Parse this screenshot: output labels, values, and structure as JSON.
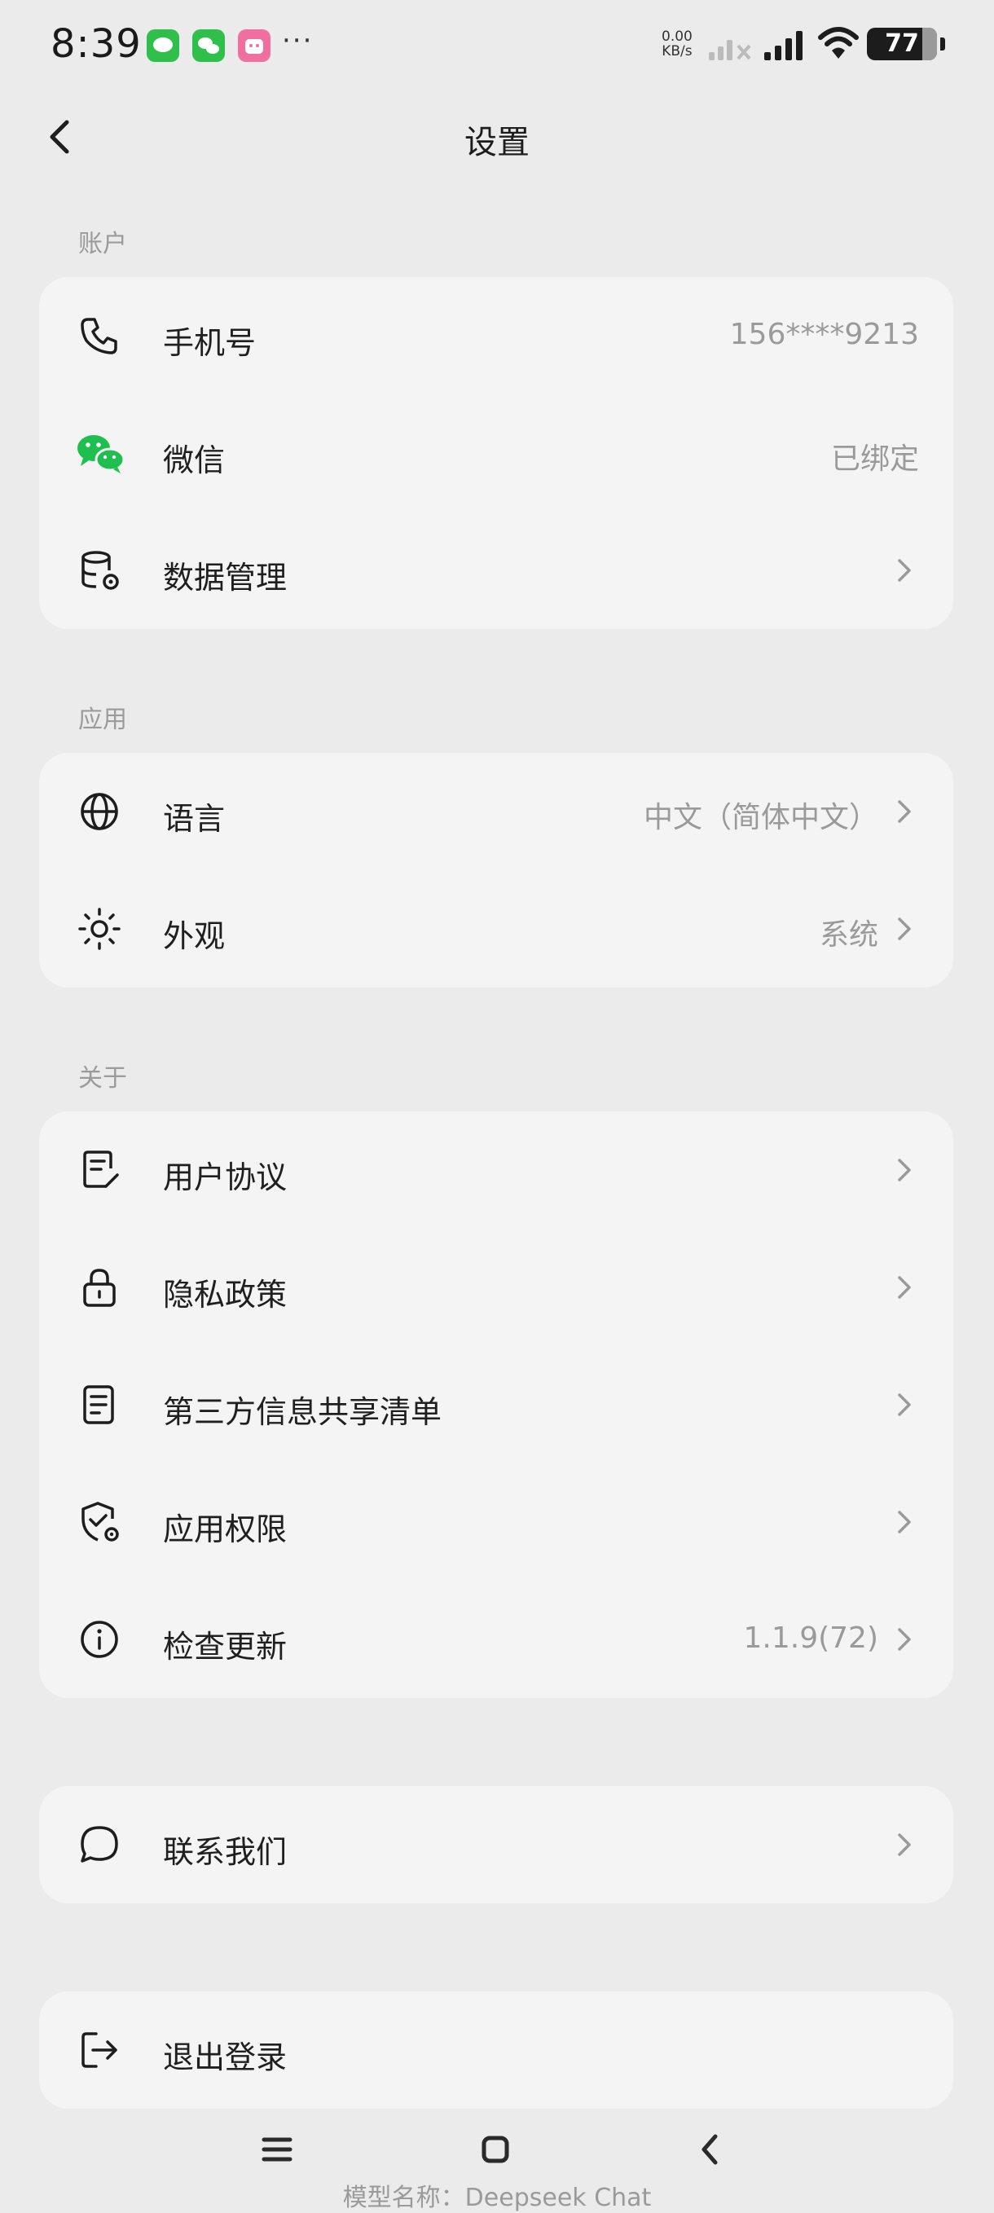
{
  "status_bar": {
    "time": "8:39",
    "overflow": "···",
    "net_speed_value": "0.00",
    "net_speed_unit": "KB/s",
    "battery": "77"
  },
  "header": {
    "title": "设置"
  },
  "sections": {
    "account": {
      "label": "账户",
      "items": [
        {
          "label": "手机号",
          "value": "156****9213",
          "icon": "phone-icon"
        },
        {
          "label": "微信",
          "value": "已绑定",
          "icon": "wechat-icon"
        },
        {
          "label": "数据管理",
          "value": "",
          "icon": "database-settings-icon"
        }
      ]
    },
    "app": {
      "label": "应用",
      "items": [
        {
          "label": "语言",
          "value": "中文（简体中文）",
          "icon": "globe-icon"
        },
        {
          "label": "外观",
          "value": "系统",
          "icon": "sun-icon"
        }
      ]
    },
    "about": {
      "label": "关于",
      "items": [
        {
          "label": "用户协议",
          "value": "",
          "icon": "document-edit-icon"
        },
        {
          "label": "隐私政策",
          "value": "",
          "icon": "lock-icon"
        },
        {
          "label": "第三方信息共享清单",
          "value": "",
          "icon": "list-document-icon"
        },
        {
          "label": "应用权限",
          "value": "",
          "icon": "shield-settings-icon"
        },
        {
          "label": "检查更新",
          "value": "1.1.9(72)",
          "icon": "info-icon"
        }
      ]
    },
    "contact": {
      "label": "联系我们",
      "icon": "chat-bubble-icon"
    },
    "logout": {
      "label": "退出登录",
      "icon": "logout-icon"
    }
  },
  "footer": {
    "model_name": "模型名称：Deepseek Chat"
  },
  "colors": {
    "background": "#ebebeb",
    "card": "#f4f4f4",
    "wechat_green": "#1fbf4f",
    "secondary_text": "#9a9a9a"
  }
}
